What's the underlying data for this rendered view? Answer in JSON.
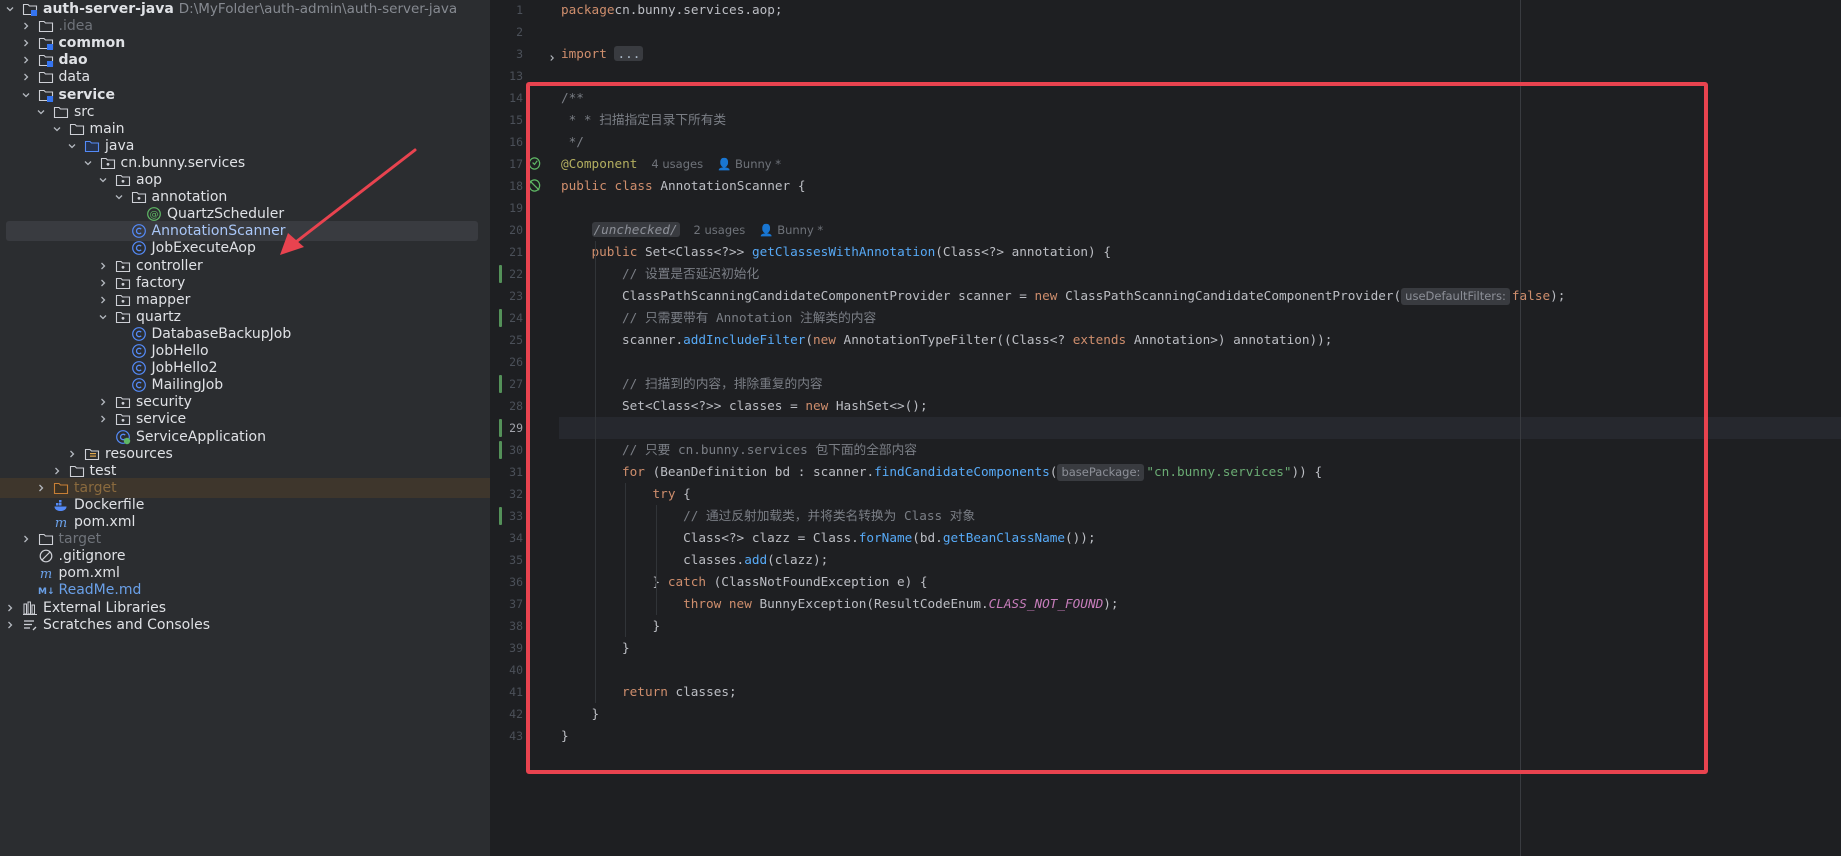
{
  "tree": {
    "rows": [
      {
        "label": "auth-server-java",
        "path": "D:\\MyFolder\\auth-admin\\auth-server-java",
        "style": "bold",
        "icon": "module-folder-icon",
        "chevron": "down",
        "indent": 0
      },
      {
        "label": ".idea",
        "style": "excluded",
        "icon": "folder-icon",
        "chevron": "right",
        "indent": 1
      },
      {
        "label": "common",
        "style": "bold",
        "icon": "module-folder-icon",
        "chevron": "right",
        "indent": 1
      },
      {
        "label": "dao",
        "style": "bold",
        "icon": "module-folder-icon",
        "chevron": "right",
        "indent": 1
      },
      {
        "label": "data",
        "style": "normal",
        "icon": "folder-icon",
        "chevron": "right",
        "indent": 1
      },
      {
        "label": "service",
        "style": "bold",
        "icon": "module-folder-icon",
        "chevron": "down",
        "indent": 1
      },
      {
        "label": "src",
        "style": "normal",
        "icon": "folder-icon",
        "chevron": "down",
        "indent": 2
      },
      {
        "label": "main",
        "style": "normal",
        "icon": "folder-icon",
        "chevron": "down",
        "indent": 3
      },
      {
        "label": "java",
        "style": "normal",
        "icon": "source-folder-icon",
        "chevron": "down",
        "indent": 4
      },
      {
        "label": "cn.bunny.services",
        "style": "normal",
        "icon": "package-icon",
        "chevron": "down",
        "indent": 5
      },
      {
        "label": "aop",
        "style": "normal",
        "icon": "package-icon",
        "chevron": "down",
        "indent": 6
      },
      {
        "label": "annotation",
        "style": "normal",
        "icon": "package-icon",
        "chevron": "down",
        "indent": 7
      },
      {
        "label": "QuartzScheduler",
        "style": "normal",
        "icon": "annotation-class-icon",
        "chevron": "none",
        "indent": 8
      },
      {
        "label": "AnnotationScanner",
        "style": "selblue",
        "icon": "class-icon",
        "chevron": "none",
        "indent": 7,
        "selected": true
      },
      {
        "label": "JobExecuteAop",
        "style": "normal",
        "icon": "class-icon",
        "chevron": "none",
        "indent": 7
      },
      {
        "label": "controller",
        "style": "normal",
        "icon": "package-icon",
        "chevron": "right",
        "indent": 6
      },
      {
        "label": "factory",
        "style": "normal",
        "icon": "package-icon",
        "chevron": "right",
        "indent": 6
      },
      {
        "label": "mapper",
        "style": "normal",
        "icon": "package-icon",
        "chevron": "right",
        "indent": 6
      },
      {
        "label": "quartz",
        "style": "normal",
        "icon": "package-icon",
        "chevron": "down",
        "indent": 6
      },
      {
        "label": "DatabaseBackupJob",
        "style": "normal",
        "icon": "class-icon",
        "chevron": "none",
        "indent": 7
      },
      {
        "label": "JobHello",
        "style": "normal",
        "icon": "class-icon",
        "chevron": "none",
        "indent": 7
      },
      {
        "label": "JobHello2",
        "style": "normal",
        "icon": "class-icon",
        "chevron": "none",
        "indent": 7
      },
      {
        "label": "MailingJob",
        "style": "normal",
        "icon": "class-icon",
        "chevron": "none",
        "indent": 7
      },
      {
        "label": "security",
        "style": "normal",
        "icon": "package-icon",
        "chevron": "right",
        "indent": 6
      },
      {
        "label": "service",
        "style": "normal",
        "icon": "package-icon",
        "chevron": "right",
        "indent": 6
      },
      {
        "label": "ServiceApplication",
        "style": "normal",
        "icon": "spring-boot-class-icon",
        "chevron": "none",
        "indent": 6
      },
      {
        "label": "resources",
        "style": "normal",
        "icon": "resources-folder-icon",
        "chevron": "right",
        "indent": 4
      },
      {
        "label": "test",
        "style": "normal",
        "icon": "folder-icon",
        "chevron": "right",
        "indent": 3
      },
      {
        "label": "target",
        "style": "excluded-or",
        "icon": "excluded-folder-icon",
        "chevron": "right",
        "indent": 2,
        "highlight": true
      },
      {
        "label": "Dockerfile",
        "style": "normal",
        "icon": "docker-icon",
        "chevron": "none",
        "indent": 2
      },
      {
        "label": "pom.xml",
        "style": "normal",
        "icon": "maven-icon",
        "chevron": "none",
        "indent": 2
      },
      {
        "label": "target",
        "style": "excluded",
        "icon": "folder-icon",
        "chevron": "right",
        "indent": 1
      },
      {
        "label": ".gitignore",
        "style": "normal",
        "icon": "ignore-file-icon",
        "chevron": "none",
        "indent": 1
      },
      {
        "label": "pom.xml",
        "style": "normal",
        "icon": "maven-icon",
        "chevron": "none",
        "indent": 1
      },
      {
        "label": "ReadMe.md",
        "style": "blue",
        "icon": "markdown-icon",
        "chevron": "none",
        "indent": 1
      },
      {
        "label": "External Libraries",
        "style": "normal",
        "icon": "libraries-icon",
        "chevron": "right",
        "indent": 0
      },
      {
        "label": "Scratches and Consoles",
        "style": "normal",
        "icon": "scratches-icon",
        "chevron": "right",
        "indent": 0
      }
    ]
  },
  "editor": {
    "current_line": 29,
    "lines": [
      {
        "n": "1",
        "tokens": [
          [
            "kw",
            "package"
          ],
          [
            "",
            "cn.bunny.services.aop;"
          ]
        ]
      },
      {
        "n": "2",
        "tokens": []
      },
      {
        "n": "3",
        "fold": true,
        "tokens": [
          [
            "kw",
            "import"
          ],
          [
            "",
            " "
          ],
          [
            "dots",
            "..."
          ]
        ]
      },
      {
        "n": "13",
        "tokens": []
      },
      {
        "n": "14",
        "tokens": [
          [
            "cmt",
            "/**"
          ]
        ]
      },
      {
        "n": "15",
        "tokens": [
          [
            "cmt",
            " * * 扫描指定目录下所有类"
          ]
        ]
      },
      {
        "n": "16",
        "tokens": [
          [
            "cmt",
            " */"
          ]
        ]
      },
      {
        "n": "17",
        "gicon": "bean-icon",
        "tokens": [
          [
            "ann",
            "@Component"
          ],
          [
            "lens",
            "4 usages"
          ],
          [
            "lens",
            "👤 Bunny *"
          ]
        ]
      },
      {
        "n": "18",
        "gicon": "bean-no-icon",
        "tokens": [
          [
            "kw",
            "public"
          ],
          [
            "",
            " "
          ],
          [
            "kw",
            "class"
          ],
          [
            "",
            " AnnotationScanner {"
          ]
        ]
      },
      {
        "n": "19",
        "tokens": []
      },
      {
        "n": "20",
        "tokens": [
          [
            "",
            " "
          ],
          [
            "uncheck",
            "/unchecked/"
          ],
          [
            "lens",
            "2 usages"
          ],
          [
            "lens",
            "👤 Bunny *"
          ]
        ]
      },
      {
        "n": "21",
        "tokens": [
          [
            "",
            " "
          ],
          [
            "kw",
            "public"
          ],
          [
            "",
            " Set<Class<?>> "
          ],
          [
            "fn",
            "getClassesWithAnnotation"
          ],
          [
            "",
            "(Class<?> annotation) {"
          ]
        ]
      },
      {
        "n": "22",
        "vcs": true,
        "tokens": [
          [
            "",
            " "
          ],
          [
            "cmt",
            "// 设置是否延迟初始化"
          ]
        ]
      },
      {
        "n": "23",
        "tokens": [
          [
            "",
            " ClassPathScanningCandidateComponentProvider scanner = "
          ],
          [
            "kw",
            "new"
          ],
          [
            "",
            " ClassPathScanningCandidateComponentProvider("
          ],
          [
            "hint",
            "useDefaultFilters:"
          ],
          [
            "kw",
            "false"
          ],
          [
            "",
            ");"
          ]
        ]
      },
      {
        "n": "24",
        "vcs": true,
        "tokens": [
          [
            "",
            " "
          ],
          [
            "cmt",
            "// 只需要带有 Annotation 注解类的内容"
          ]
        ]
      },
      {
        "n": "25",
        "tokens": [
          [
            "",
            " scanner."
          ],
          [
            "mcall",
            "addIncludeFilter"
          ],
          [
            "",
            "("
          ],
          [
            "kw",
            "new"
          ],
          [
            "",
            " AnnotationTypeFilter((Class<? "
          ],
          [
            "kw",
            "extends"
          ],
          [
            "",
            " Annotation>) annotation));"
          ]
        ]
      },
      {
        "n": "26",
        "tokens": []
      },
      {
        "n": "27",
        "vcs": true,
        "tokens": [
          [
            "",
            " "
          ],
          [
            "cmt",
            "// 扫描到的内容，排除重复的内容"
          ]
        ]
      },
      {
        "n": "28",
        "tokens": [
          [
            "",
            " Set<Class<?>> classes = "
          ],
          [
            "kw",
            "new"
          ],
          [
            "",
            " HashSet<>();"
          ]
        ]
      },
      {
        "n": "29",
        "vcs": true,
        "tokens": []
      },
      {
        "n": "30",
        "vcs": true,
        "tokens": [
          [
            "",
            " "
          ],
          [
            "cmt",
            "// 只要 cn.bunny.services 包下面的全部内容"
          ]
        ]
      },
      {
        "n": "31",
        "tokens": [
          [
            "",
            " "
          ],
          [
            "kw",
            "for"
          ],
          [
            "",
            " (BeanDefinition bd : scanner."
          ],
          [
            "mcall",
            "findCandidateComponents"
          ],
          [
            "",
            "("
          ],
          [
            "hint",
            "basePackage:"
          ],
          [
            "str",
            "\"cn.bunny.services\""
          ],
          [
            "",
            ")) {"
          ]
        ]
      },
      {
        "n": "32",
        "tokens": [
          [
            "",
            " "
          ],
          [
            "kw",
            "try"
          ],
          [
            "",
            " {"
          ]
        ]
      },
      {
        "n": "33",
        "vcs": true,
        "tokens": [
          [
            "",
            " "
          ],
          [
            "cmt",
            "// 通过反射加载类，并将类名转换为 Class 对象"
          ]
        ]
      },
      {
        "n": "34",
        "tokens": [
          [
            "",
            " Class<?> clazz = Class."
          ],
          [
            "mcall",
            "forName"
          ],
          [
            "",
            "(bd."
          ],
          [
            "mcall",
            "getBeanClassName"
          ],
          [
            "",
            "());"
          ]
        ]
      },
      {
        "n": "35",
        "tokens": [
          [
            "",
            " classes."
          ],
          [
            "mcall",
            "add"
          ],
          [
            "",
            "(clazz);"
          ]
        ]
      },
      {
        "n": "36",
        "tokens": [
          [
            "",
            " } "
          ],
          [
            "kw",
            "catch"
          ],
          [
            "",
            " (ClassNotFoundException e) {"
          ]
        ]
      },
      {
        "n": "37",
        "tokens": [
          [
            "",
            " "
          ],
          [
            "kw",
            "throw"
          ],
          [
            "",
            " "
          ],
          [
            "kw",
            "new"
          ],
          [
            "",
            " BunnyException(ResultCodeEnum."
          ],
          [
            "cn",
            "CLASS_NOT_FOUND"
          ],
          [
            "",
            ");"
          ]
        ]
      },
      {
        "n": "38",
        "tokens": [
          [
            "",
            " }"
          ]
        ]
      },
      {
        "n": "39",
        "tokens": [
          [
            "",
            " }"
          ]
        ]
      },
      {
        "n": "40",
        "tokens": []
      },
      {
        "n": "41",
        "tokens": [
          [
            "",
            " "
          ],
          [
            "kw",
            "return"
          ],
          [
            "",
            " classes;"
          ]
        ]
      },
      {
        "n": "42",
        "tokens": [
          [
            "",
            " }"
          ]
        ]
      },
      {
        "n": "43",
        "tokens": [
          [
            "",
            "}"
          ]
        ]
      }
    ]
  },
  "colors": {
    "accent_red": "#e8434f",
    "vcs_green": "#549159",
    "keyword": "#cf8e6d",
    "string": "#6aab73",
    "comment": "#7a7e85",
    "annotation": "#b3ae60",
    "method": "#56a8f5",
    "constant": "#c77dbb"
  }
}
